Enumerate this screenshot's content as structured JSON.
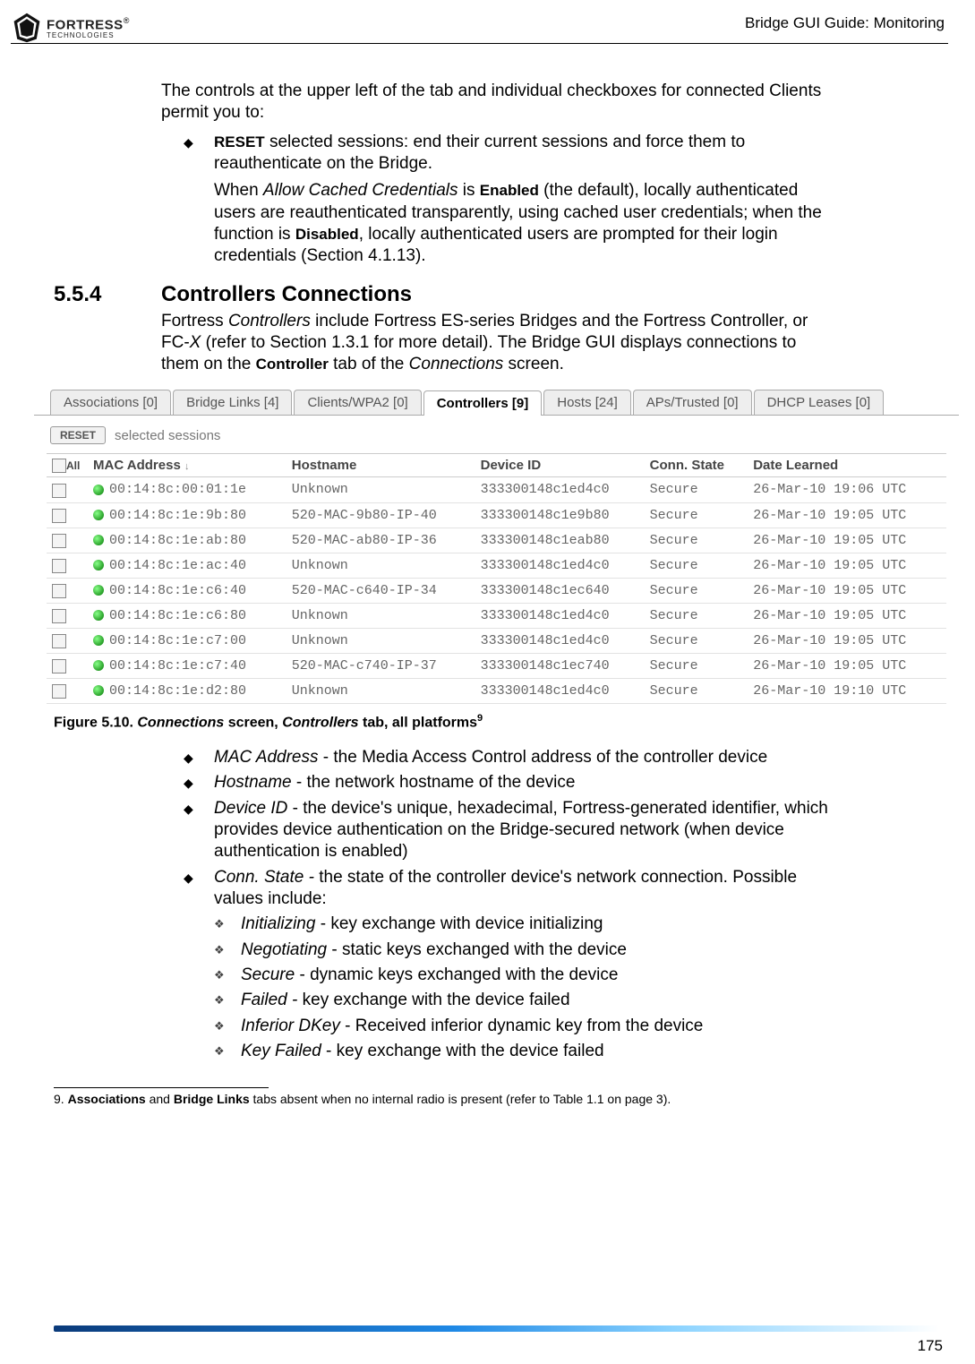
{
  "header": {
    "logo_main": "FORTRESS",
    "logo_reg": "®",
    "logo_sub": "TECHNOLOGIES",
    "right": "Bridge GUI Guide: Monitoring"
  },
  "intro_para": "The controls at the upper left of the tab and individual checkboxes for connected Clients permit you to:",
  "reset_bullet": {
    "lead_word": "RESET",
    "rest": " selected sessions: end their current sessions and force them to reauthenticate on the Bridge.",
    "continue_1": "When ",
    "continue_it1": "Allow Cached Credentials",
    "continue_2": " is ",
    "continue_b1": "Enabled",
    "continue_3": " (the default), locally authenticated users are reauthenticated transparently, using cached user credentials; when the function is ",
    "continue_b2": "Disabled",
    "continue_4": ", locally authenticated users are prompted for their login credentials (Section 4.1.13)."
  },
  "section": {
    "num": "5.5.4",
    "title": "Controllers Connections",
    "p1a": "Fortress ",
    "p1i1": "Controllers",
    "p1b": " include Fortress ES-series Bridges and the Fortress Controller, or FC-",
    "p1i2": "X",
    "p1c": " (refer to Section 1.3.1 for more detail). The Bridge GUI displays connections to them on the ",
    "p1bold": "Controller",
    "p1d": " tab of the ",
    "p1i3": "Connections",
    "p1e": " screen."
  },
  "tabs": {
    "t0": "Associations [0]",
    "t1": "Bridge Links [4]",
    "t2": "Clients/WPA2 [0]",
    "t3": "Controllers [9]",
    "t4": "Hosts [24]",
    "t5": "APs/Trusted [0]",
    "t6": "DHCP Leases [0]"
  },
  "panel": {
    "reset_btn": "RESET",
    "reset_label": "selected sessions",
    "all_checkbox_label": "All"
  },
  "cols": {
    "c0": "MAC Address",
    "c1": "Hostname",
    "c2": "Device ID",
    "c3": "Conn. State",
    "c4": "Date Learned"
  },
  "rows": [
    {
      "mac": "00:14:8c:00:01:1e",
      "host": "Unknown",
      "dev": "333300148c1ed4c0",
      "state": "Secure",
      "date": "26-Mar-10 19:06 UTC"
    },
    {
      "mac": "00:14:8c:1e:9b:80",
      "host": "520-MAC-9b80-IP-40",
      "dev": "333300148c1e9b80",
      "state": "Secure",
      "date": "26-Mar-10 19:05 UTC"
    },
    {
      "mac": "00:14:8c:1e:ab:80",
      "host": "520-MAC-ab80-IP-36",
      "dev": "333300148c1eab80",
      "state": "Secure",
      "date": "26-Mar-10 19:05 UTC"
    },
    {
      "mac": "00:14:8c:1e:ac:40",
      "host": "Unknown",
      "dev": "333300148c1ed4c0",
      "state": "Secure",
      "date": "26-Mar-10 19:05 UTC"
    },
    {
      "mac": "00:14:8c:1e:c6:40",
      "host": "520-MAC-c640-IP-34",
      "dev": "333300148c1ec640",
      "state": "Secure",
      "date": "26-Mar-10 19:05 UTC"
    },
    {
      "mac": "00:14:8c:1e:c6:80",
      "host": "Unknown",
      "dev": "333300148c1ed4c0",
      "state": "Secure",
      "date": "26-Mar-10 19:05 UTC"
    },
    {
      "mac": "00:14:8c:1e:c7:00",
      "host": "Unknown",
      "dev": "333300148c1ed4c0",
      "state": "Secure",
      "date": "26-Mar-10 19:05 UTC"
    },
    {
      "mac": "00:14:8c:1e:c7:40",
      "host": "520-MAC-c740-IP-37",
      "dev": "333300148c1ec740",
      "state": "Secure",
      "date": "26-Mar-10 19:05 UTC"
    },
    {
      "mac": "00:14:8c:1e:d2:80",
      "host": "Unknown",
      "dev": "333300148c1ed4c0",
      "state": "Secure",
      "date": "26-Mar-10 19:10 UTC"
    }
  ],
  "fig_caption": {
    "prefix": "Figure 5.10. ",
    "it1": "Connections",
    "mid1": " screen, ",
    "it2": "Controllers",
    "mid2": " tab, all platforms",
    "sup": "9"
  },
  "defs": [
    {
      "term": "MAC Address",
      "rest": " - the Media Access Control address of the controller device"
    },
    {
      "term": "Hostname",
      "rest": " - the network hostname of the device"
    },
    {
      "term": "Device ID",
      "rest": " - the device's unique, hexadecimal, Fortress-generated identifier, which provides device authentication on the Bridge-secured network (when device authentication is enabled)"
    },
    {
      "term": "Conn. State -",
      "rest": " the state of the controller device's network connection. Possible values include:"
    }
  ],
  "states": [
    {
      "term": "Initializing",
      "rest": " - key exchange with device initializing"
    },
    {
      "term": "Negotiating",
      "rest": " - static keys exchanged with the device"
    },
    {
      "term": "Secure",
      "rest": " - dynamic keys exchanged with the device"
    },
    {
      "term": "Failed -",
      "rest": " key exchange with the device failed"
    },
    {
      "term": "Inferior DKey",
      "rest": " - Received inferior dynamic key from the device"
    },
    {
      "term": "Key Failed",
      "rest": " - key exchange with the device failed"
    }
  ],
  "footnote": {
    "num": "9.",
    "b1": "Associations",
    "mid1": " and ",
    "b2": "Bridge Links",
    "rest": " tabs absent when no internal radio is present (refer to Table 1.1 on page 3)."
  },
  "page_number": "175"
}
